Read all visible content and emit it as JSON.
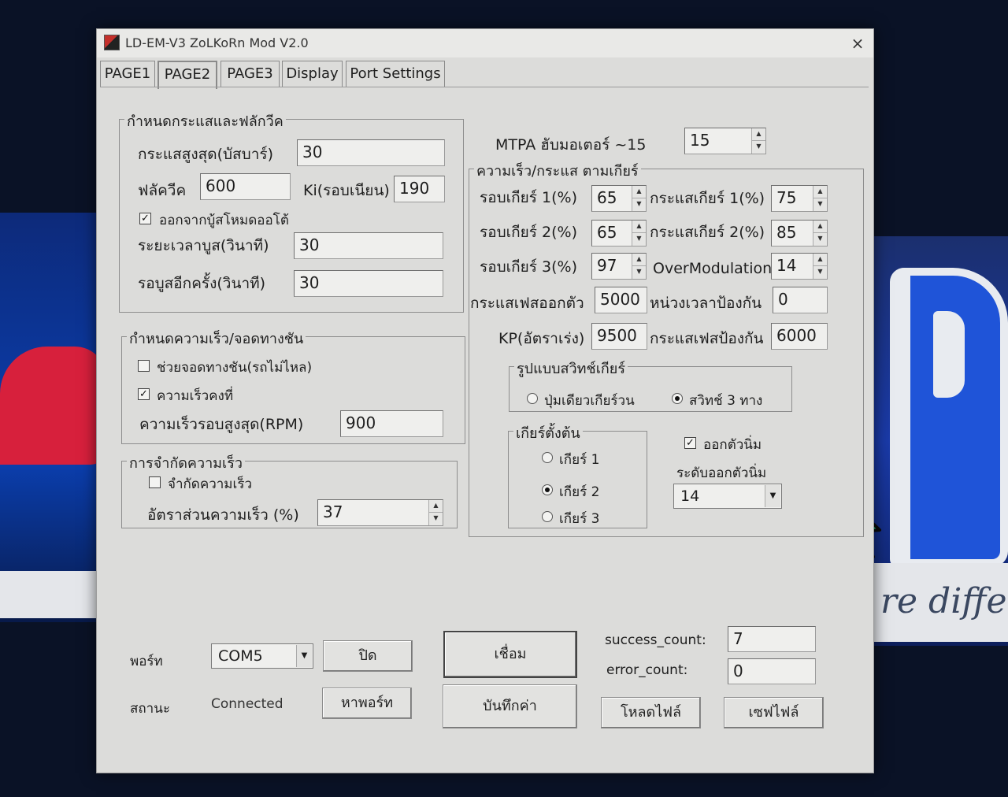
{
  "window": {
    "title": "LD-EM-V3 ZoLKoRn Mod V2.0",
    "close": "×"
  },
  "tabs": [
    "PAGE1",
    "PAGE2",
    "PAGE3",
    "Display",
    "Port Settings"
  ],
  "active_tab": "PAGE2",
  "current_limit": {
    "title": "กำหนดกระแสและฟลักวีค",
    "max_current_label": "กระแสสูงสุด(บัสบาร์)",
    "max_current_value": "30",
    "flux_weak_label": "ฟลัควีค",
    "flux_weak_value": "600",
    "ki_label": "Ki(รอบเนียน)",
    "ki_value": "190",
    "exit_boost_label": "ออกจากบู้สโหมดออโต้",
    "exit_boost_checked": true,
    "boost_time_label": "ระยะเวลาบูส(วินาที)",
    "boost_time_value": "30",
    "boost_repeat_label": "รอบูสอีกครั้ง(วินาที)",
    "boost_repeat_value": "30"
  },
  "speed_hill": {
    "title": "กำหนดความเร็ว/จอดทางชัน",
    "hill_hold_label": "ช่วยจอดทางชัน(รถไม่ไหล)",
    "hill_hold_checked": false,
    "cruise_label": "ความเร็วคงที่",
    "cruise_checked": true,
    "max_rpm_label": "ความเร็วรอบสูงสุด(RPM)",
    "max_rpm_value": "900"
  },
  "speed_limit": {
    "title": "การจำกัดความเร็ว",
    "limit_label": "จำกัดความเร็ว",
    "limit_checked": false,
    "ratio_label": "อัตราส่วนความเร็ว (%)",
    "ratio_value": "37"
  },
  "mtpa": {
    "label": "MTPA  ฮับมอเตอร์ ~15",
    "value": "15"
  },
  "gear": {
    "title": "ความเร็ว/กระแส ตามเกียร์",
    "g1_speed_label": "รอบเกียร์ 1(%)",
    "g1_speed_value": "65",
    "g1_current_label": "กระแสเกียร์ 1(%)",
    "g1_current_value": "75",
    "g2_speed_label": "รอบเกียร์ 2(%)",
    "g2_speed_value": "65",
    "g2_current_label": "กระแสเกียร์ 2(%)",
    "g2_current_value": "85",
    "g3_speed_label": "รอบเกียร์ 3(%)",
    "g3_speed_value": "97",
    "overmod_label": "OverModulation",
    "overmod_value": "14",
    "phase_start_label": "กระแสเฟสออกตัว",
    "phase_start_value": "5000",
    "delay_label": "หน่วงเวลาป้องกัน",
    "delay_value": "0",
    "kp_label": "KP(อัตราเร่ง)",
    "kp_value": "9500",
    "phase_protect_label": "กระแสเฟสป้องกัน",
    "phase_protect_value": "6000"
  },
  "switch_mode": {
    "title": "รูปแบบสวิทช์เกียร์",
    "option1": "ปุ่มเดียวเกียร์วน",
    "option2": "สวิทช์ 3 ทาง",
    "selected": "option2"
  },
  "default_gear": {
    "title": "เกียร์ตั้งต้น",
    "options": [
      "เกียร์ 1",
      "เกียร์ 2",
      "เกียร์ 3"
    ],
    "selected": 1
  },
  "soft_start": {
    "label": "ออกตัวนิ่ม",
    "checked": true,
    "level_label": "ระดับออกตัวนิ่ม",
    "level_value": "14"
  },
  "port": {
    "port_label": "พอร์ท",
    "port_value": "COM5",
    "close_button": "ปิด",
    "connect_button": "เชื่อม",
    "status_label": "สถานะ",
    "status_value": "Connected",
    "find_port_button": "หาพอร์ท",
    "save_button": "บันทึกค่า",
    "load_file_button": "โหลดไฟล์",
    "save_file_button": "เซฟไฟล์",
    "success_label": "success_count:",
    "success_value": "7",
    "error_label": "error_count:",
    "error_value": "0"
  },
  "background": {
    "script_text": "re differ",
    "arrow": ">"
  }
}
